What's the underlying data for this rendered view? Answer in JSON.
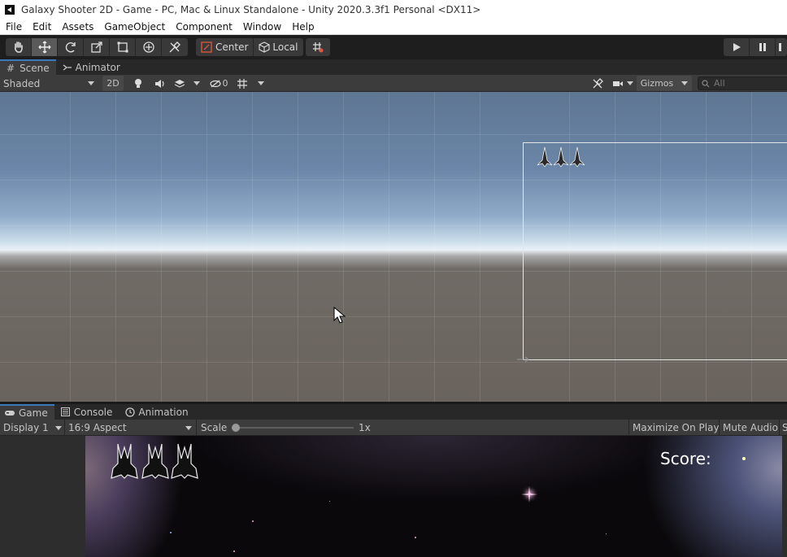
{
  "window": {
    "title": "Galaxy Shooter 2D - Game - PC, Mac & Linux Standalone - Unity 2020.3.3f1 Personal <DX11>"
  },
  "menu": [
    "File",
    "Edit",
    "Assets",
    "GameObject",
    "Component",
    "Window",
    "Help"
  ],
  "toolbar": {
    "tools": [
      "hand-tool-icon",
      "move-tool-icon",
      "rotate-tool-icon",
      "scale-tool-icon",
      "rect-tool-icon",
      "transform-tool-icon",
      "custom-tool-icon"
    ],
    "active_tool": "move-tool-icon",
    "pivot_label": "Center",
    "space_label": "Local"
  },
  "scene_tabs": [
    {
      "label": "Scene",
      "icon": "hash-icon",
      "active": true
    },
    {
      "label": "Animator",
      "icon": "animator-icon",
      "active": false
    }
  ],
  "scene_toolbar": {
    "shading_mode": "Shaded",
    "mode_2d_label": "2D",
    "hidden_count": "0",
    "gizmos_label": "Gizmos",
    "search_placeholder": "All"
  },
  "game_tabs": [
    {
      "label": "Game",
      "icon": "gamepad-icon",
      "active": true
    },
    {
      "label": "Console",
      "icon": "console-icon",
      "active": false
    },
    {
      "label": "Animation",
      "icon": "clock-icon",
      "active": false
    }
  ],
  "game_toolbar": {
    "display": "Display 1",
    "aspect": "16:9 Aspect",
    "scale_label": "Scale",
    "scale_value": "1x",
    "maximize_label": "Maximize On Play",
    "mute_label": "Mute Audio",
    "stats_label": "S"
  },
  "game": {
    "score_label": "Score:",
    "lives": 3
  },
  "colors": {
    "editor_bg": "#383838",
    "toolbar_bg": "#1e1e1e",
    "tab_accent": "#3a79bb"
  }
}
